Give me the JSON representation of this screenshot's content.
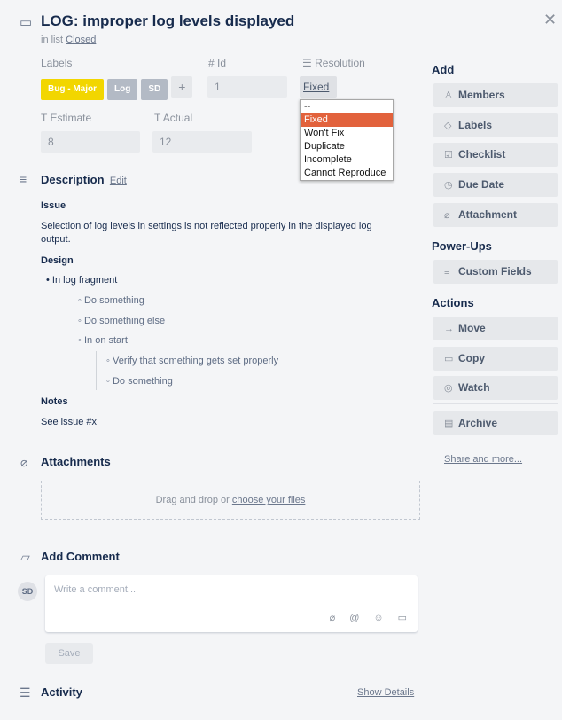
{
  "card": {
    "title": "LOG: improper log levels displayed",
    "in_list_prefix": "in list",
    "list_name": "Closed"
  },
  "fields": {
    "labels_header": "Labels",
    "labels": [
      {
        "text": "Bug - Major",
        "color": "#f2d600"
      },
      {
        "text": "Log",
        "color": "#b3bac5"
      },
      {
        "text": "SD",
        "color": "#b3bac5"
      }
    ],
    "add_label": "+",
    "id_header": "# Id",
    "id_value": "1",
    "resolution_header": "Resolution",
    "resolution_value": "Fixed",
    "estimate_header": "Estimate",
    "estimate_value": "8",
    "actual_header": "Actual",
    "actual_value": "12"
  },
  "resolution_dropdown": {
    "options": [
      "--",
      "Fixed",
      "Won't Fix",
      "Duplicate",
      "Incomplete",
      "Cannot Reproduce"
    ],
    "selected": "Fixed"
  },
  "description": {
    "header": "Description",
    "edit": "Edit",
    "issue_h": "Issue",
    "issue_text": "Selection of log levels in settings is not reflected properly in the displayed log output.",
    "design_h": "Design",
    "items": {
      "l1": "In log fragment",
      "l2a": "Do something",
      "l2b": "Do something else",
      "l2c": "In on start",
      "l3a": "Verify that something gets set properly",
      "l3b": "Do something"
    },
    "notes_h": "Notes",
    "notes_text": "See issue #x"
  },
  "attachments": {
    "header": "Attachments",
    "drop_text": "Drag and drop or",
    "choose_link": "choose your files"
  },
  "comment": {
    "header": "Add Comment",
    "avatar": "SD",
    "placeholder": "Write a comment...",
    "save": "Save"
  },
  "activity": {
    "header": "Activity",
    "show_details": "Show Details"
  },
  "sidebar": {
    "add_h": "Add",
    "add_items": [
      "Members",
      "Labels",
      "Checklist",
      "Due Date",
      "Attachment"
    ],
    "powerups_h": "Power-Ups",
    "powerups_items": [
      "Custom Fields"
    ],
    "actions_h": "Actions",
    "actions_items": [
      "Move",
      "Copy",
      "Watch",
      "Archive"
    ],
    "share": "Share and more..."
  },
  "colors": {
    "accent_selected": "#e2623c"
  }
}
